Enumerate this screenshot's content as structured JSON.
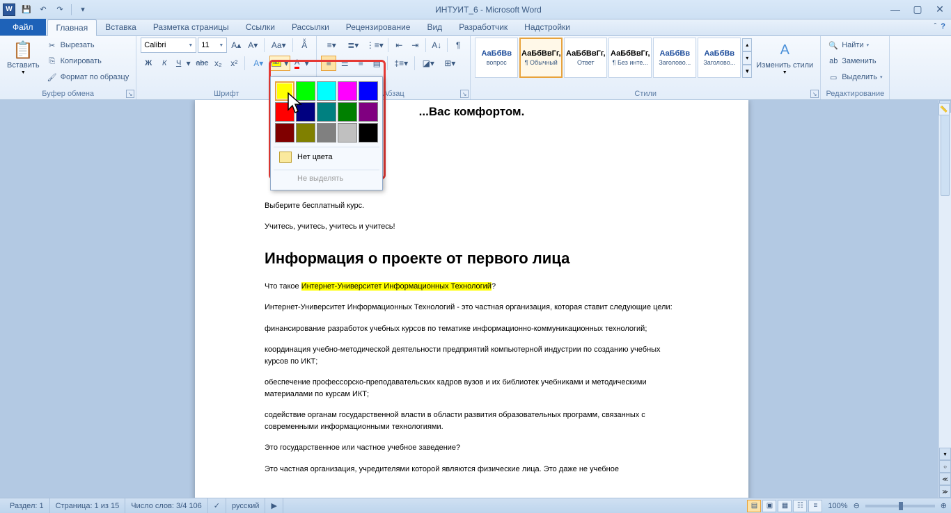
{
  "title": "ИНТУИТ_6 - Microsoft Word",
  "tabs": {
    "file": "Файл",
    "items": [
      "Главная",
      "Вставка",
      "Разметка страницы",
      "Ссылки",
      "Рассылки",
      "Рецензирование",
      "Вид",
      "Разработчик",
      "Надстройки"
    ],
    "active": 0
  },
  "clipboard": {
    "paste": "Вставить",
    "cut": "Вырезать",
    "copy": "Копировать",
    "format_painter": "Формат по образцу",
    "label": "Буфер обмена"
  },
  "font": {
    "name": "Calibri",
    "size": "11",
    "label": "Шрифт"
  },
  "paragraph": {
    "label": "Абзац"
  },
  "styles": {
    "label": "Стили",
    "change": "Изменить стили",
    "items": [
      {
        "preview": "АаБбВв",
        "name": "вопрос",
        "blue": true
      },
      {
        "preview": "АаБбВвГг,",
        "name": "¶ Обычный",
        "blue": false,
        "selected": true
      },
      {
        "preview": "АаБбВвГг,",
        "name": "Ответ",
        "blue": false
      },
      {
        "preview": "АаБбВвГг,",
        "name": "¶ Без инте...",
        "blue": false
      },
      {
        "preview": "АаБбВв",
        "name": "Заголово...",
        "blue": true
      },
      {
        "preview": "АаБбВв",
        "name": "Заголово...",
        "blue": true
      }
    ]
  },
  "editing": {
    "find": "Найти",
    "replace": "Заменить",
    "select": "Выделить",
    "label": "Редактирование"
  },
  "color_picker": {
    "colors": [
      [
        "#ffff00",
        "#00ff00",
        "#00ffff",
        "#ff00ff",
        "#0000ff"
      ],
      [
        "#ff0000",
        "#000080",
        "#008080",
        "#008000",
        "#800080"
      ],
      [
        "#800000",
        "#808000",
        "#808080",
        "#c0c0c0",
        "#000000"
      ]
    ],
    "no_color": "Нет цвета",
    "no_highlight": "Не выделять"
  },
  "document": {
    "top_partial": "...Вас комфортом.",
    "line1": "Выберите бесплатный курс.",
    "line2": "Учитесь, учитесь, учитесь и учитесь!",
    "heading": "Информация о проекте от первого лица",
    "q1_pre": "Что такое ",
    "q1_hl": "Интернет-Университет Информационных Технологий",
    "q1_post": "?",
    "p1": "Интернет-Университет Информационных Технологий - это частная организация, которая ставит следующие цели:",
    "p2": "финансирование разработок учебных курсов по тематике информационно-коммуникационных технологий;",
    "p3": "координация учебно-методической деятельности предприятий компьютерной индустрии по созданию учебных курсов по ИКТ;",
    "p4": "обеспечение профессорско-преподавательских кадров вузов и их библиотек учебниками и методическими материалами по курсам ИКТ;",
    "p5": "содействие органам государственной власти в области развития образовательных программ, связанных с современными информационными технологиями.",
    "q2": "Это государственное или частное учебное заведение?",
    "p6": "Это частная организация, учредителями которой являются физические лица. Это даже не учебное"
  },
  "status": {
    "section": "Раздел: 1",
    "page": "Страница: 1 из 15",
    "words": "Число слов: 3/4 106",
    "lang": "русский",
    "zoom": "100%"
  }
}
